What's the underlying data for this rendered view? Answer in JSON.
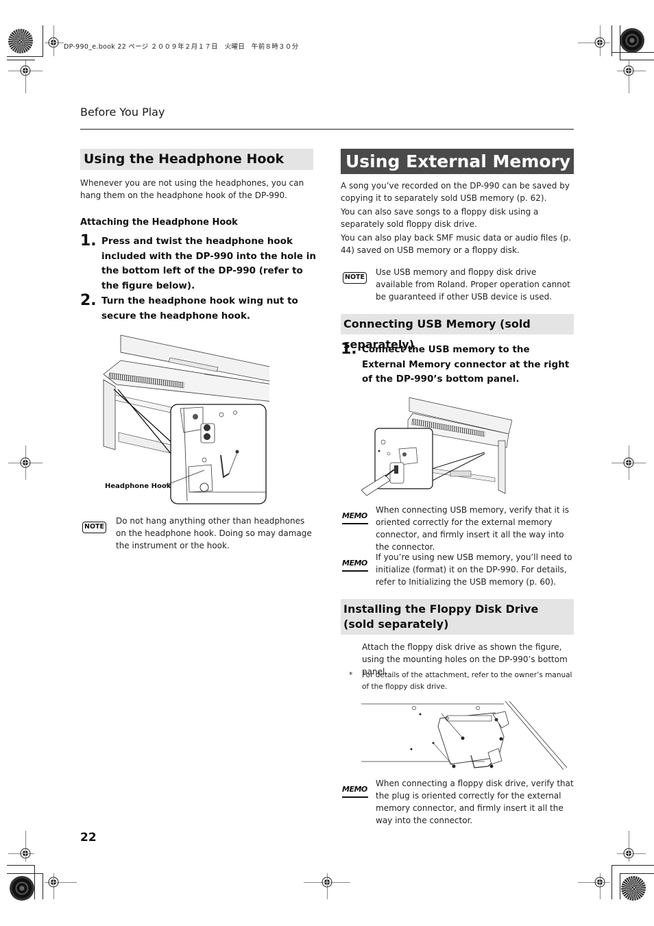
{
  "slug": "DP-990_e.book  22 ページ  ２００９年２月１７日　火曜日　午前８時３０分",
  "running_head": "Before You Play",
  "page_number": "22",
  "left": {
    "title": "Using the Headphone Hook",
    "intro": "Whenever you are not using the headphones, you can hang them on the headphone hook of the DP-990.",
    "subheading": "Attaching the Headphone Hook",
    "steps": [
      {
        "num": "1.",
        "text": "Press and twist the headphone hook included with the DP-990 into the hole in the bottom left of the DP-990 (refer to the figure below)."
      },
      {
        "num": "2.",
        "text": "Turn the headphone hook wing nut to secure the headphone hook."
      }
    ],
    "figure_label": "Headphone Hook",
    "note": {
      "icon": "NOTE",
      "text": "Do not hang anything other than headphones on the headphone hook. Doing so may damage the instrument or the hook."
    }
  },
  "right": {
    "title": "Using External Memory",
    "intro_paragraphs": [
      "A song you’ve recorded on the DP-990 can be saved by copying it to separately sold USB memory (p. 62).",
      "You can also save songs to a floppy disk using a separately sold floppy disk drive.",
      "You can also play back SMF music data or audio files (p. 44) saved on USB memory or a floppy disk."
    ],
    "note": {
      "icon": "NOTE",
      "text": "Use USB memory and floppy disk drive available from Roland. Proper operation cannot be guaranteed if other USB device is used."
    },
    "usb_section": {
      "title": "Connecting USB Memory (sold separately)",
      "steps": [
        {
          "num": "1.",
          "text": "Connect the USB memory to the External Memory connector at the right of the DP-990’s bottom panel."
        }
      ],
      "memos": [
        {
          "icon": "MEMO",
          "text": "When connecting USB memory, verify that it is oriented correctly for the external memory connector, and firmly insert it all the way into the connector."
        },
        {
          "icon": "MEMO",
          "text": "If you’re using new USB memory, you’ll need to initialize (format) it on the DP-990. For details, refer to Initializing the USB memory (p. 60)."
        }
      ]
    },
    "floppy_section": {
      "title": "Installing the Floppy Disk Drive (sold separately)",
      "text": "Attach the floppy disk drive as shown the figure, using the mounting holes on the DP-990’s bottom panel.",
      "footnote_mark": "*",
      "footnote": "For details of the attachment, refer to the owner’s manual of the floppy disk drive.",
      "memo": {
        "icon": "MEMO",
        "text": "When connecting a floppy disk drive, verify that the plug is oriented correctly for the external memory connector, and firmly insert it all the way into the connector."
      }
    }
  }
}
